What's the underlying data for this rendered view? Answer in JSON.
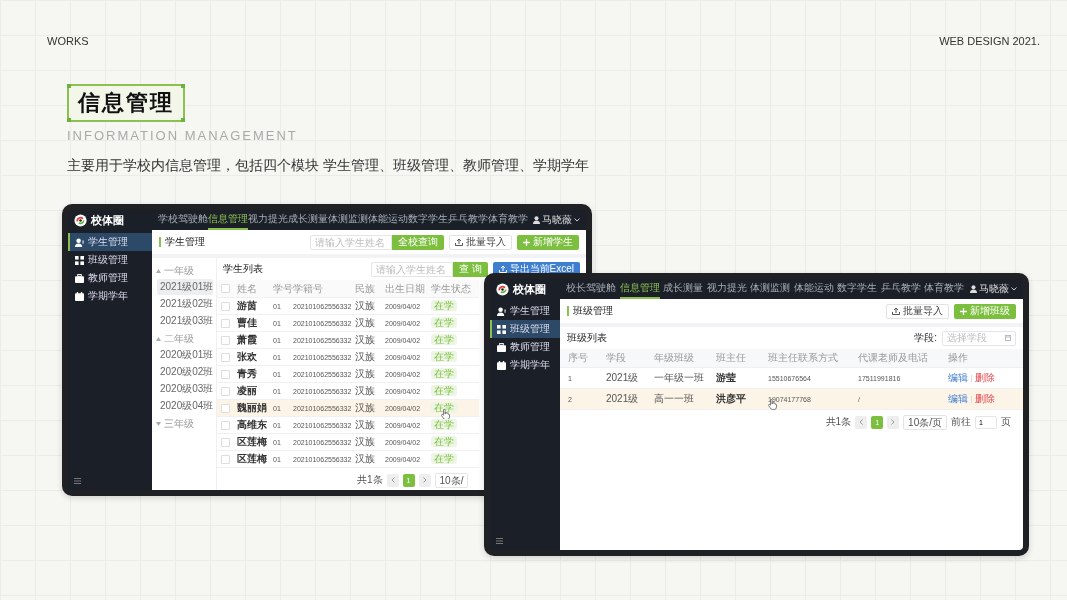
{
  "page_header": {
    "label": "WORKS",
    "year_label": "WEB DESIGN 2021."
  },
  "title": "信息管理",
  "subtitle": "INFORMATION MANAGEMENT",
  "description": "主要用于学校内信息管理，包括四个模块 学生管理、班级管理、教师管理、学期学年",
  "student_screen": {
    "app_bar": {
      "logo": "校体圈",
      "user": "马晓薇",
      "nav": [
        {
          "label": "学校驾驶舱",
          "selected": false
        },
        {
          "label": "信息管理",
          "selected": true
        },
        {
          "label": "视力提光",
          "selected": false
        },
        {
          "label": "成长测量",
          "selected": false
        },
        {
          "label": "体测监测",
          "selected": false
        },
        {
          "label": "体能运动",
          "selected": false
        },
        {
          "label": "数字学生",
          "selected": false
        },
        {
          "label": "乒乓教学",
          "selected": false
        },
        {
          "label": "体育教学",
          "selected": false
        }
      ]
    },
    "sidebar": [
      {
        "label": "学生管理",
        "selected": true
      },
      {
        "label": "班级管理",
        "selected": false
      },
      {
        "label": "教师管理",
        "selected": false
      },
      {
        "label": "学期学年",
        "selected": false
      }
    ],
    "section_title": "学生管理",
    "search": {
      "placeholder": "请输入学生姓名"
    },
    "buttons": [
      "全校查询",
      "批量导入",
      "新增学生"
    ],
    "tree": [
      {
        "label": "一年级",
        "expanded": true,
        "children": [
          {
            "label": "2021级01班",
            "selected": true
          },
          {
            "label": "2021级02班",
            "selected": false
          },
          {
            "label": "2021级03班",
            "selected": false
          }
        ]
      },
      {
        "label": "二年级",
        "expanded": true,
        "children": [
          {
            "label": "2020级01班",
            "selected": false
          },
          {
            "label": "2020级02班",
            "selected": false
          },
          {
            "label": "2020级03班",
            "selected": false
          },
          {
            "label": "2020级04班",
            "selected": false
          }
        ]
      },
      {
        "label": "三年级",
        "expanded": false
      }
    ],
    "list_title": "学生列表",
    "list_search": {
      "placeholder": "请输入学生姓名"
    },
    "list_buttons": [
      "查 询",
      "导出当前Excel"
    ],
    "header_checked": false,
    "columns": [
      "姓名",
      "学号",
      "学籍号",
      "民族",
      "出生日期",
      "学生状态"
    ],
    "rows": [
      {
        "checked": false,
        "highlighted": false,
        "name": "游茵",
        "number": "01",
        "registry": "202101062556332",
        "ethnicity": "汉族",
        "birth": "2009/04/02",
        "status": "在学"
      },
      {
        "checked": false,
        "highlighted": false,
        "name": "曹佳",
        "number": "01",
        "registry": "202101062556332",
        "ethnicity": "汉族",
        "birth": "2009/04/02",
        "status": "在学"
      },
      {
        "checked": false,
        "highlighted": false,
        "name": "萧霞",
        "number": "01",
        "registry": "202101062556332",
        "ethnicity": "汉族",
        "birth": "2009/04/02",
        "status": "在学"
      },
      {
        "checked": false,
        "highlighted": false,
        "name": "张欢",
        "number": "01",
        "registry": "202101062556332",
        "ethnicity": "汉族",
        "birth": "2009/04/02",
        "status": "在学"
      },
      {
        "checked": false,
        "highlighted": false,
        "name": "青秀",
        "number": "01",
        "registry": "202101062556332",
        "ethnicity": "汉族",
        "birth": "2009/04/02",
        "status": "在学"
      },
      {
        "checked": false,
        "highlighted": false,
        "name": "凌丽",
        "number": "01",
        "registry": "202101062556332",
        "ethnicity": "汉族",
        "birth": "2009/04/02",
        "status": "在学"
      },
      {
        "checked": false,
        "highlighted": true,
        "name": "魏丽娟",
        "number": "01",
        "registry": "202101062556332",
        "ethnicity": "汉族",
        "birth": "2009/04/02",
        "status": "在学"
      },
      {
        "checked": false,
        "highlighted": false,
        "name": "高维东",
        "number": "01",
        "registry": "202101062556332",
        "ethnicity": "汉族",
        "birth": "2009/04/02",
        "status": "在学"
      },
      {
        "checked": false,
        "highlighted": false,
        "name": "区莲梅",
        "number": "01",
        "registry": "202101062556332",
        "ethnicity": "汉族",
        "birth": "2009/04/02",
        "status": "在学"
      },
      {
        "checked": false,
        "highlighted": false,
        "name": "区莲梅",
        "number": "01",
        "registry": "202101062556332",
        "ethnicity": "汉族",
        "birth": "2009/04/02",
        "status": "在学"
      }
    ],
    "pagination": {
      "total": "共1条",
      "pages": [
        {
          "label": "1",
          "selected": true
        }
      ],
      "page_size": "10条/"
    }
  },
  "class_screen": {
    "app_bar": {
      "logo": "校体圈",
      "user": "马晓薇",
      "nav": [
        {
          "label": "校长驾驶舱",
          "selected": false
        },
        {
          "label": "信息管理",
          "selected": true
        },
        {
          "label": "成长测量",
          "selected": false
        },
        {
          "label": "视力提光",
          "selected": false
        },
        {
          "label": "体测监测",
          "selected": false
        },
        {
          "label": "体能运动",
          "selected": false
        },
        {
          "label": "数字学生",
          "selected": false
        },
        {
          "label": "乒乓教学",
          "selected": false
        },
        {
          "label": "体育教学",
          "selected": false
        }
      ]
    },
    "sidebar": [
      {
        "label": "学生管理",
        "selected": false
      },
      {
        "label": "班级管理",
        "selected": true
      },
      {
        "label": "教师管理",
        "selected": false
      },
      {
        "label": "学期学年",
        "selected": false
      }
    ],
    "section_title": "班级管理",
    "buttons": [
      "批量导入",
      "新增班级"
    ],
    "list_title": "班级列表",
    "filter": {
      "label": "学段:",
      "placeholder": "选择学段"
    },
    "columns": [
      "序号",
      "学段",
      "年级班级",
      "班主任",
      "班主任联系方式",
      "代课老师及电话",
      "操作"
    ],
    "rows": [
      {
        "highlighted": false,
        "index": "1",
        "stage": "2021级",
        "class_name": "一年级一班",
        "teacher": "游莹",
        "phone": "15510676564",
        "substitute": "17511991816",
        "edit": "编辑",
        "delete": "删除"
      },
      {
        "highlighted": true,
        "index": "2",
        "stage": "2021级",
        "class_name": "高一一班",
        "teacher": "洪彦平",
        "phone": "19074177768",
        "substitute": "/",
        "edit": "编辑",
        "delete": "删除"
      }
    ],
    "pagination": {
      "total": "共1条",
      "pages": [
        {
          "label": "1",
          "selected": true
        }
      ],
      "page_size": "10条/页",
      "goto_label": "前往",
      "goto_value": "1",
      "page_unit": "页"
    }
  }
}
